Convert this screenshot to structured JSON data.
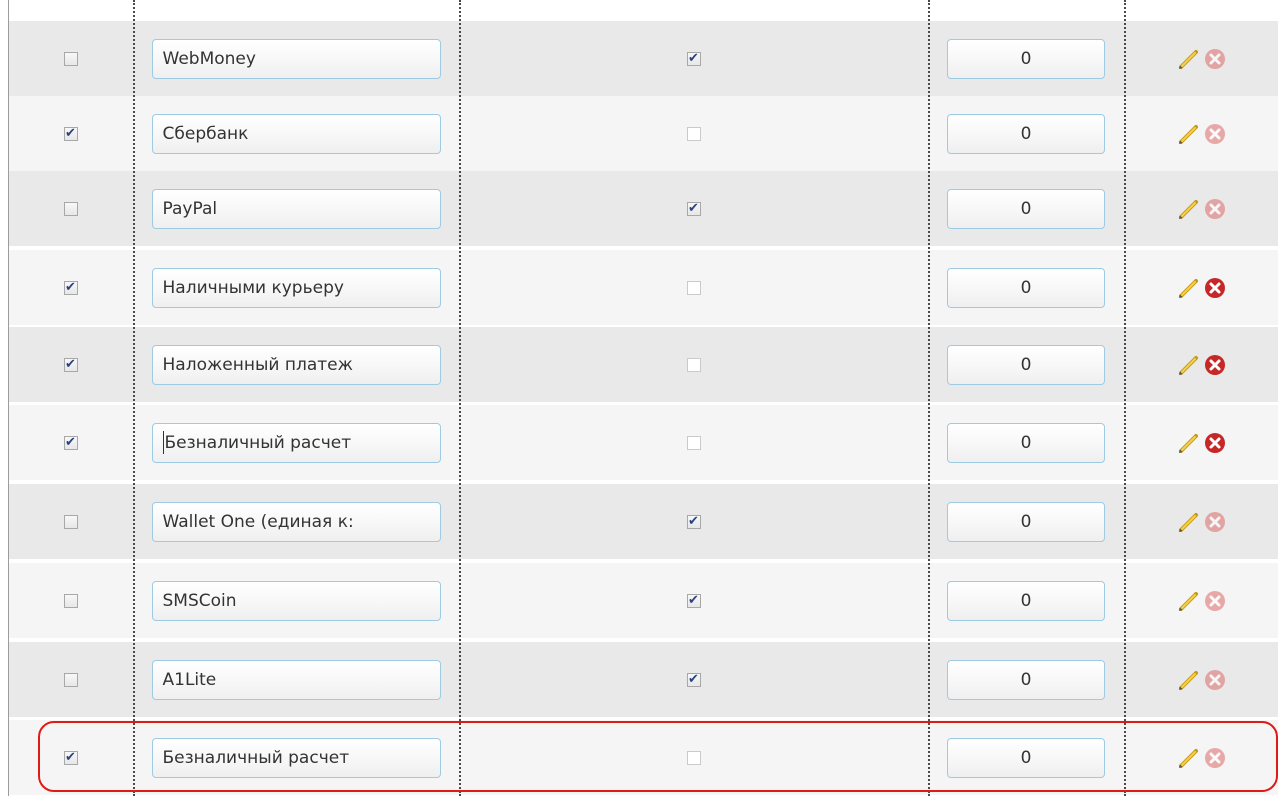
{
  "payment_methods": [
    {
      "enabled": false,
      "name": "WebMoney",
      "online": true,
      "order": "0",
      "delete_active": false,
      "caret": false
    },
    {
      "enabled": true,
      "name": "Сбербанк",
      "online": false,
      "order": "0",
      "delete_active": false,
      "caret": false
    },
    {
      "enabled": false,
      "name": "PayPal",
      "online": true,
      "order": "0",
      "delete_active": false,
      "caret": false
    },
    {
      "enabled": true,
      "name": "Наличными курьеру",
      "online": false,
      "order": "0",
      "delete_active": true,
      "caret": false
    },
    {
      "enabled": true,
      "name": "Наложенный платеж",
      "online": false,
      "order": "0",
      "delete_active": true,
      "caret": false
    },
    {
      "enabled": true,
      "name": "Безналичный расчет",
      "online": false,
      "order": "0",
      "delete_active": true,
      "caret": true
    },
    {
      "enabled": false,
      "name": "Wallet One (единая к:",
      "online": true,
      "order": "0",
      "delete_active": false,
      "caret": false
    },
    {
      "enabled": false,
      "name": "SMSCoin",
      "online": true,
      "order": "0",
      "delete_active": false,
      "caret": false
    },
    {
      "enabled": false,
      "name": "A1Lite",
      "online": true,
      "order": "0",
      "delete_active": false,
      "caret": false
    },
    {
      "enabled": true,
      "name": "Безналичный расчет",
      "online": false,
      "order": "0",
      "delete_active": false,
      "caret": false
    }
  ],
  "icons": {
    "edit": "pencil-icon",
    "delete": "delete-icon"
  },
  "colors": {
    "checkmark": "#27427f",
    "input_border": "#9ecbe3",
    "delete_active": "#c62828",
    "highlight_border": "#e01919",
    "row_odd": "#e9e9e9",
    "row_even": "#f5f5f5"
  }
}
